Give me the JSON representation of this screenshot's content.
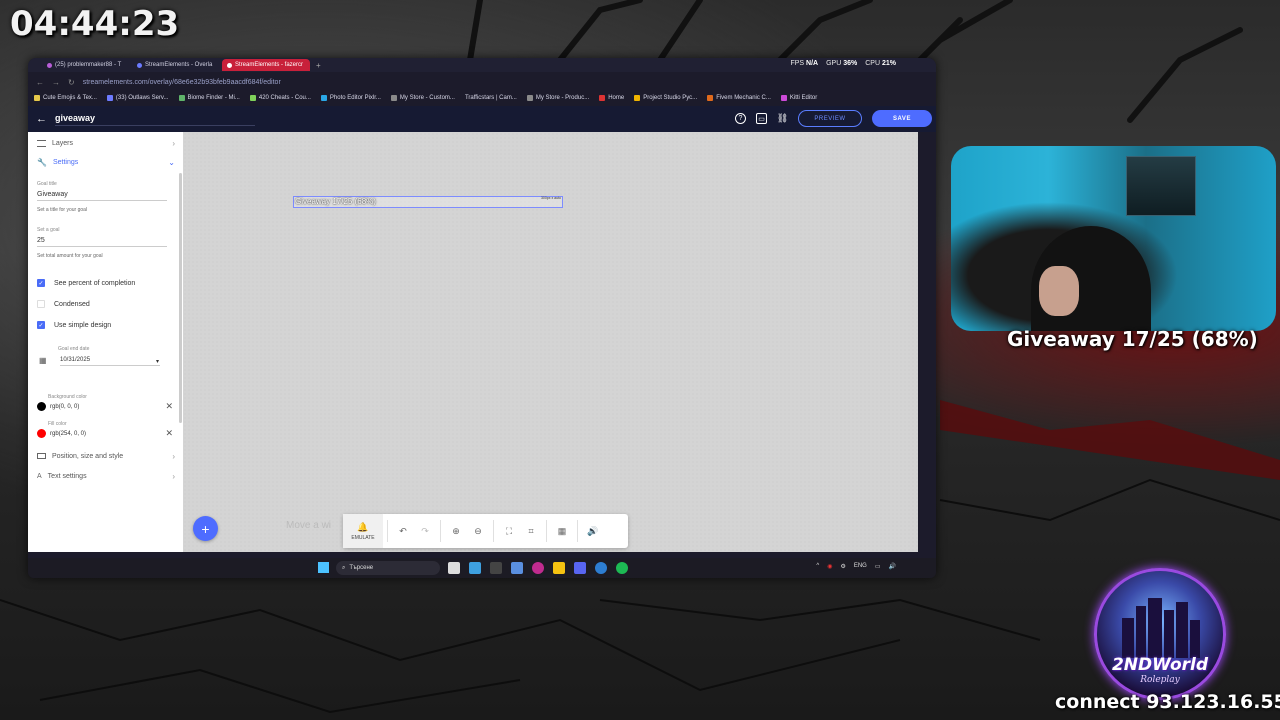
{
  "stream": {
    "timer": "04:44:23",
    "webcam_caption": "Giveaway 17/25 (68%)",
    "connect_text": "connect 93.123.16.55",
    "logo_title": "2NDWorld",
    "logo_subtitle": "Roleplay"
  },
  "browser": {
    "tabs": [
      {
        "label": "(25) problemmaker88 - T"
      },
      {
        "label": "StreamElements - Overla"
      },
      {
        "label": "StreamElements - fazercr"
      }
    ],
    "new_tab": "+",
    "stats": {
      "fps_label": "FPS",
      "fps_value": "N/A",
      "gpu_label": "GPU",
      "gpu_value": "36%",
      "cpu_label": "CPU",
      "cpu_value": "21%"
    },
    "url": "streamelements.com/overlay/68e6e32b93bfeb9aacdf684f/editor",
    "bookmarks": [
      "Cute Emojis & Tex...",
      "(33) Outlaws Serv...",
      "Biome Finder - Mi...",
      "420 Cheats - Cou...",
      "Photo Editor Pixlr...",
      "My Store - Custom...",
      "Trafficstars | Cam...",
      "My Store - Produc...",
      "Home",
      "Project Studio Рус...",
      "Fivem Mechanic C...",
      "Kitti Editor"
    ]
  },
  "editor": {
    "overlay_name": "giveaway",
    "preview_label": "PREVIEW",
    "save_label": "SAVE",
    "sidebar": {
      "layers_label": "Layers",
      "settings_label": "Settings",
      "goal_title_label": "Goal title",
      "goal_title_value": "Giveaway",
      "goal_title_help": "Set a title for your goal",
      "goal_label": "Set a goal",
      "goal_value": "25",
      "goal_help": "Set total amount for your goal",
      "checkboxes": [
        {
          "label": "See percent of completion",
          "checked": true
        },
        {
          "label": "Condensed",
          "checked": false
        },
        {
          "label": "Use simple design",
          "checked": true
        }
      ],
      "end_date_label": "Goal end date",
      "end_date_value": "10/31/2025",
      "bg_color_label": "Background color",
      "bg_color_value": "rgb(0, 0, 0)",
      "bg_color_hex": "#000000",
      "fill_color_label": "Fill color",
      "fill_color_value": "rgb(254, 0, 0)",
      "fill_color_hex": "#fe0000",
      "position_label": "Position, size and style",
      "text_settings_label": "Text settings"
    },
    "canvas": {
      "widget_text": "Giveaway 17/25 (68%)",
      "widget_size": "300px x auto",
      "hint_text": "Move a wi"
    },
    "toolbar": {
      "emulate_label": "EMULATE"
    }
  },
  "taskbar": {
    "search_placeholder": "Търсене",
    "language": "ENG"
  }
}
